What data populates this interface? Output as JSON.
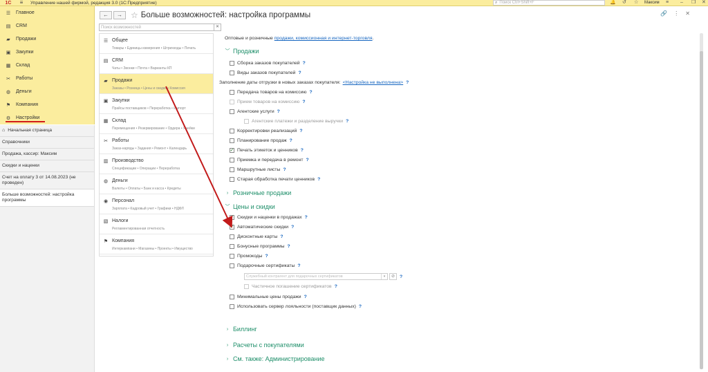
{
  "topbar": {
    "logo": "1С",
    "app_title": "Управление нашей фирмой, редакция 3.0  (1С:Предприятие)",
    "search_placeholder": "Поиск Ctrl+Shift+F",
    "user": "Максим"
  },
  "sections": [
    {
      "label": "Главное",
      "icon": "menu-icon"
    },
    {
      "label": "CRM",
      "icon": "crm-icon"
    },
    {
      "label": "Продажи",
      "icon": "cart-icon"
    },
    {
      "label": "Закупки",
      "icon": "truck-icon"
    },
    {
      "label": "Склад",
      "icon": "warehouse-icon"
    },
    {
      "label": "Работы",
      "icon": "tools-icon"
    },
    {
      "label": "Деньги",
      "icon": "money-icon"
    },
    {
      "label": "Компания",
      "icon": "flag-icon"
    },
    {
      "label": "Настройки",
      "icon": "gear-icon"
    }
  ],
  "open_windows": [
    {
      "label": "Начальная страница"
    },
    {
      "label": "Справочники"
    },
    {
      "label": "Продажа, кассир: Максим"
    },
    {
      "label": "Скидки и наценки"
    },
    {
      "label": "Счет на оплату 3 от 14.08.2023 (не проведен)"
    },
    {
      "label": "Больше возможностей: настройка программы"
    }
  ],
  "header": {
    "title": "Больше возможностей: настройка программы"
  },
  "feature_search_placeholder": "Поиск возможностей",
  "feature_nav": [
    {
      "label": "Общее",
      "sub": "Товары • Единицы измерения • Штрихкоды • Печать"
    },
    {
      "label": "CRM",
      "sub": "Чаты • Звонки • Почта • Варианты КП"
    },
    {
      "label": "Продажи",
      "sub": "Заказы • Розница • Цены и скидки • Комиссия"
    },
    {
      "label": "Закупки",
      "sub": "Прайсы поставщиков • Переработка • Импорт"
    },
    {
      "label": "Склад",
      "sub": "Перемещения • Резервирование • Ордера • Ячейки"
    },
    {
      "label": "Работы",
      "sub": "Заказ-наряды • Задания • Ремонт • Календарь"
    },
    {
      "label": "Производство",
      "sub": "Спецификации • Операции • Переработка"
    },
    {
      "label": "Деньги",
      "sub": "Валюты • Оплаты • Банк и касса • Кредиты"
    },
    {
      "label": "Персонал",
      "sub": "Зарплата • Кадровый учет • Графики • НДФЛ"
    },
    {
      "label": "Налоги",
      "sub": "Регламентированная отчетность"
    },
    {
      "label": "Компания",
      "sub": "Интеркампани • Магазины • Проекты • Имущество"
    }
  ],
  "content": {
    "intro_text": "Оптовые и розничные ",
    "intro_link": "продажи, комиссионная и интернет-торговля",
    "intro_end": ".",
    "group_sales": "Продажи",
    "cb_sborka": "Сборка заказов покупателей",
    "cb_vidy": "Виды заказов покупателей",
    "fill_dates_text": "Заполнение даты отгрузки в новых заказах покупателя:",
    "fill_dates_link": "<Настройка не выполнена>",
    "cb_peredacha": "Передача товаров на комиссию",
    "cb_priem": "Прием товаров на комиссию",
    "cb_agent": "Агентские услуги",
    "cb_agent_pay": "Агентские платежи и разделение выручки",
    "cb_korr": "Корректировки реализаций",
    "cb_plan": "Планирование продаж",
    "cb_print": "Печать этикеток и ценников",
    "cb_repair": "Приемка и передача в ремонт",
    "cb_routes": "Маршрутные листы",
    "cb_oldprint": "Старая обработка печати ценников",
    "group_retail": "Розничные продажи",
    "group_prices": "Цены и скидки",
    "cb_markups": "Скидки и наценки в продажах",
    "cb_auto": "Автоматические скидки",
    "cb_discount_cards": "Дисконтные карты",
    "cb_bonus": "Бонусные программы",
    "cb_promo": "Промокоды",
    "cb_gift": "Подарочные сертификаты",
    "gift_placeholder": "Служебный контрагент для подарочных сертификатов",
    "cb_partial": "Частичное погашение сертификатов",
    "cb_minprice": "Минимальные цены продажи",
    "cb_loyalty": "Использовать сервер лояльности (поставщик данных)",
    "group_billing": "Биллинг",
    "group_settlements": "Расчеты с покупателями",
    "group_seealso": "См. также: Администрирование"
  },
  "check_mark": "✓",
  "help_mark": "?",
  "colors": {
    "accent_yellow": "#fbed9e",
    "group_green": "#1f8f6a",
    "link_blue": "#1565c0",
    "arrow_red": "#c21a1a"
  }
}
